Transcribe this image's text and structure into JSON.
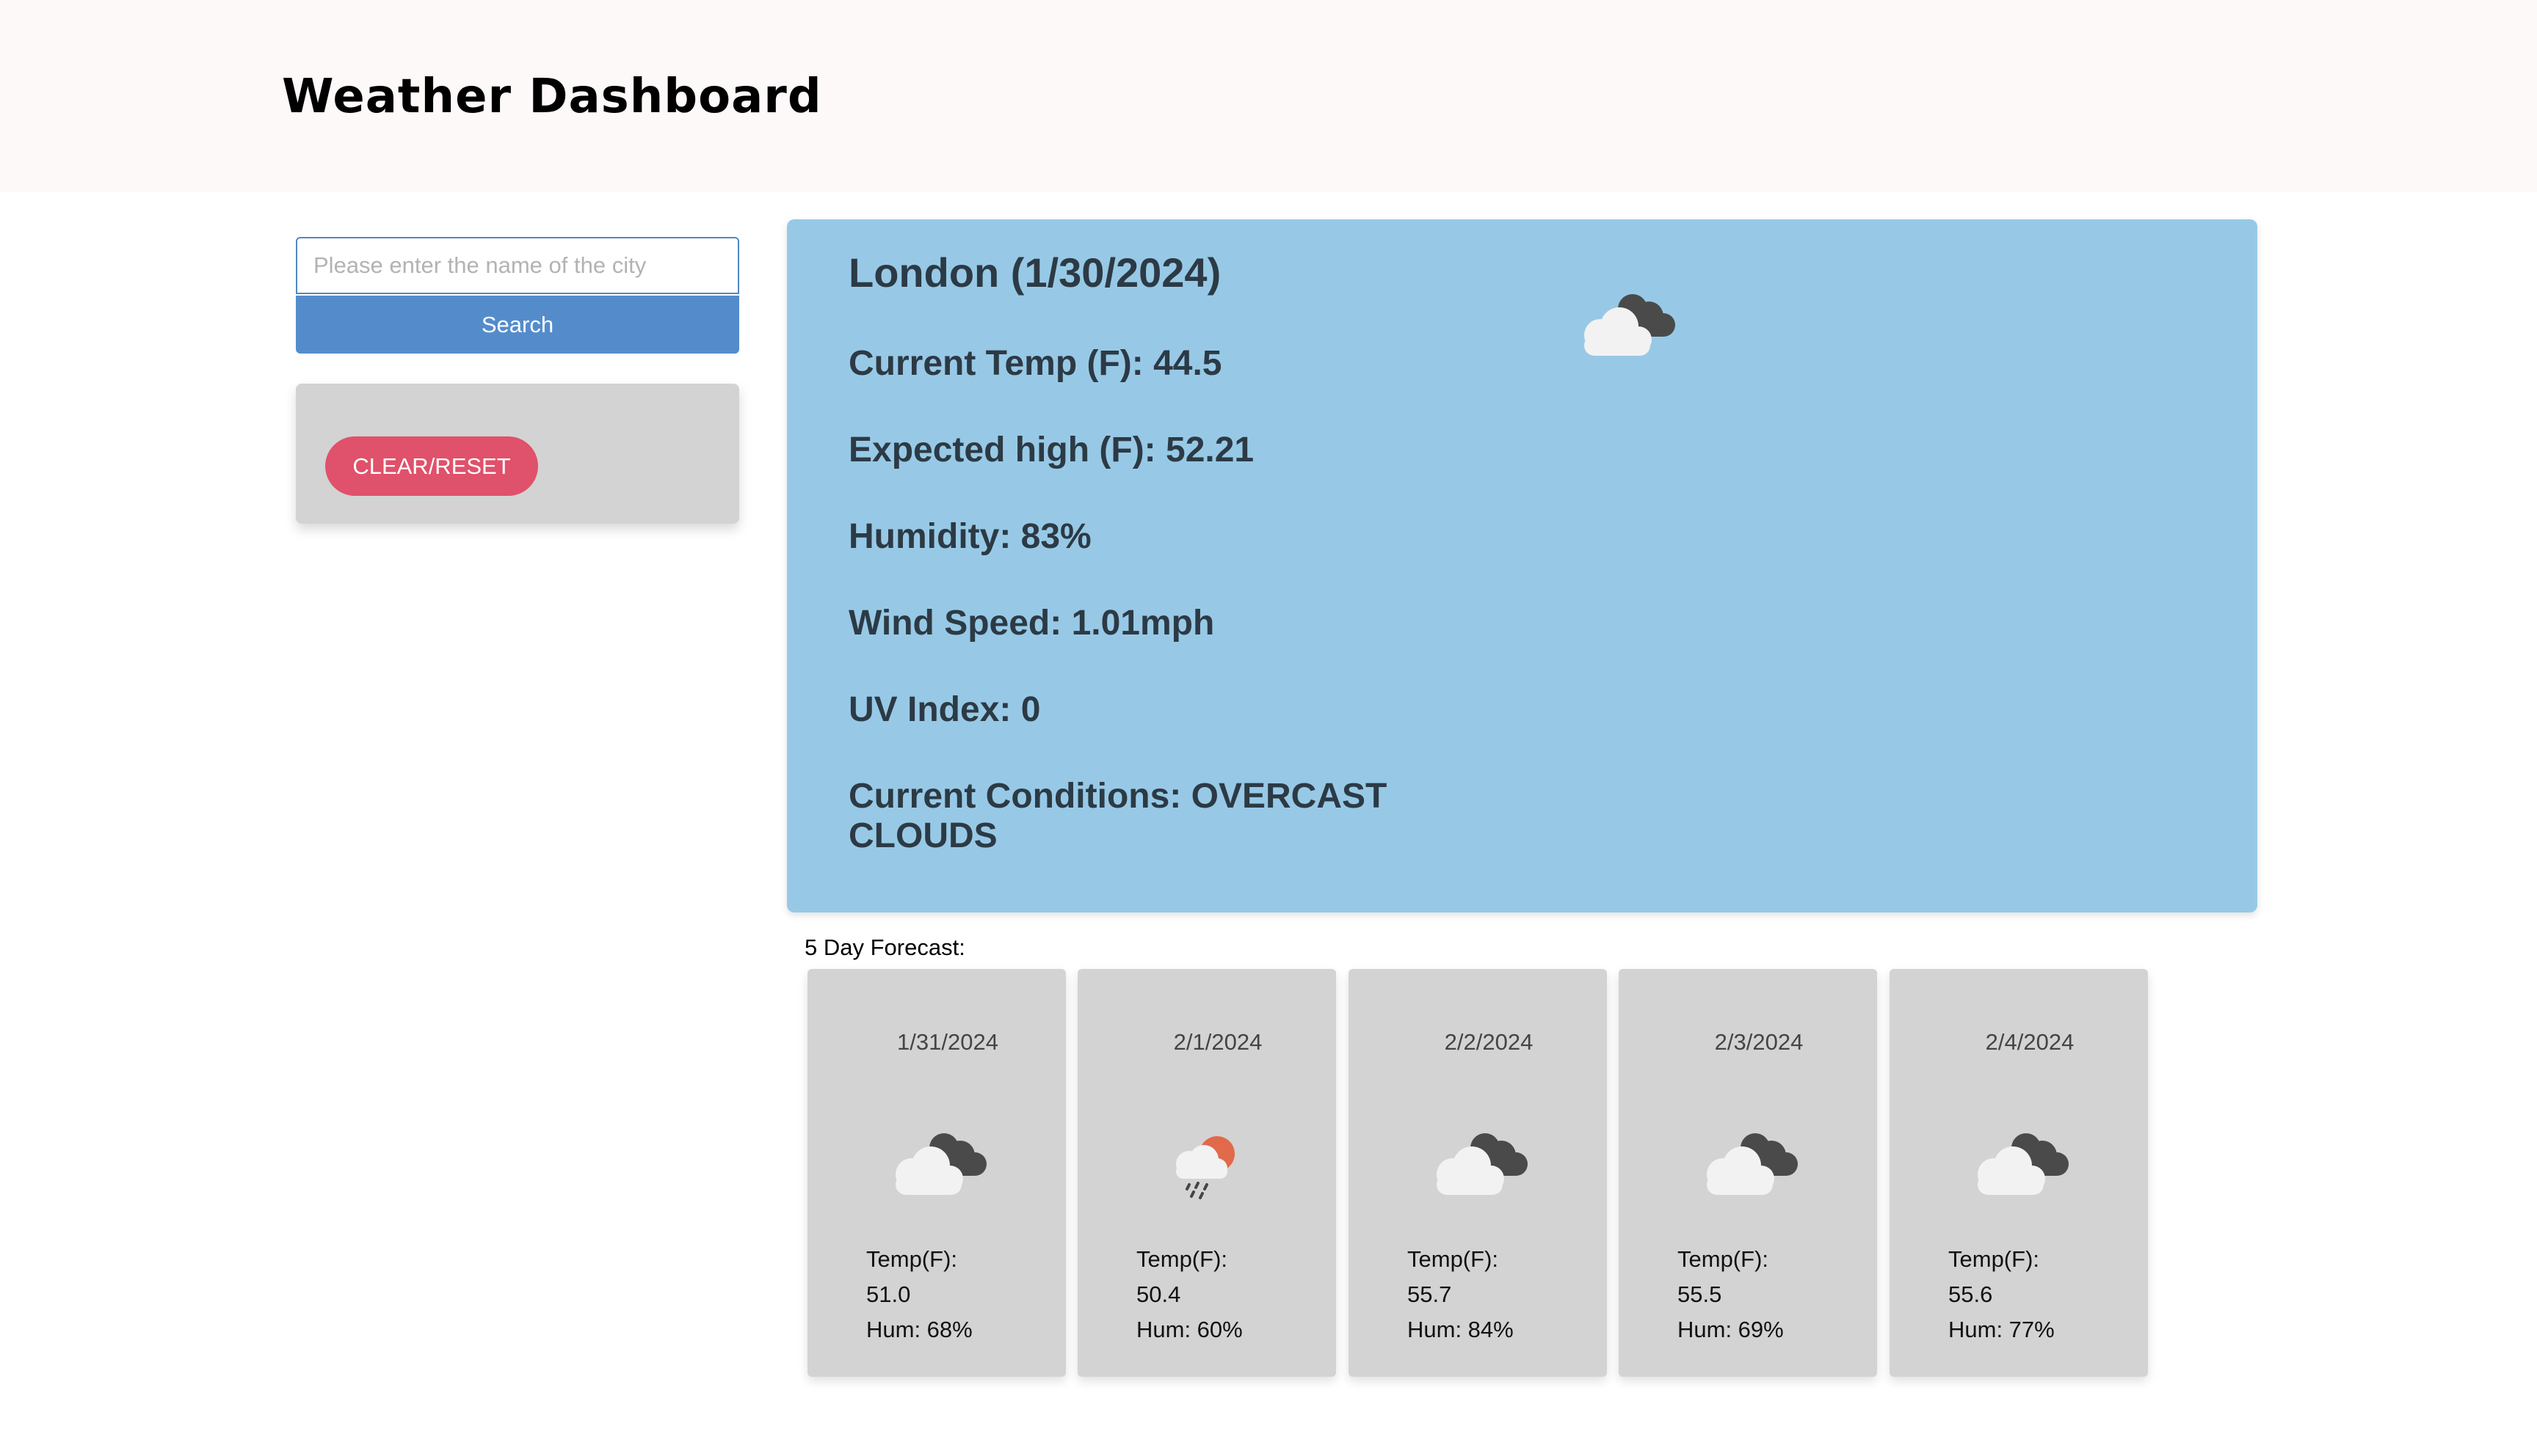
{
  "header": {
    "title": "Weather Dashboard"
  },
  "search": {
    "placeholder": "Please enter the name of the city",
    "value": "",
    "button_label": "Search"
  },
  "history": {
    "clear_label": "CLEAR/RESET"
  },
  "current": {
    "city_date": "London (1/30/2024)",
    "temp": "Current Temp (F): 44.5",
    "high": "Expected high (F): 52.21",
    "humidity": "Humidity: 83%",
    "wind": "Wind Speed: 1.01mph",
    "uv": "UV Index: 0",
    "conditions": "Current Conditions: OVERCAST CLOUDS",
    "icon": "overcast-clouds-icon"
  },
  "forecast": {
    "label": "5 Day Forecast:",
    "days": [
      {
        "date": "1/31/2024",
        "icon": "overcast-clouds-icon",
        "temp_label": "Temp(F):",
        "temp": "51.0",
        "hum": "Hum: 68%"
      },
      {
        "date": "2/1/2024",
        "icon": "rain-sun-icon",
        "temp_label": "Temp(F):",
        "temp": "50.4",
        "hum": "Hum: 60%"
      },
      {
        "date": "2/2/2024",
        "icon": "overcast-clouds-icon",
        "temp_label": "Temp(F):",
        "temp": "55.7",
        "hum": "Hum: 84%"
      },
      {
        "date": "2/3/2024",
        "icon": "overcast-clouds-icon",
        "temp_label": "Temp(F):",
        "temp": "55.5",
        "hum": "Hum: 69%"
      },
      {
        "date": "2/4/2024",
        "icon": "overcast-clouds-icon",
        "temp_label": "Temp(F):",
        "temp": "55.6",
        "hum": "Hum: 77%"
      }
    ]
  },
  "colors": {
    "header_bg": "#fdf9f8",
    "current_card_bg": "#97c9e6",
    "search_button": "#548ccb",
    "clear_button": "#e0516b",
    "card_bg": "#d3d3d3"
  }
}
